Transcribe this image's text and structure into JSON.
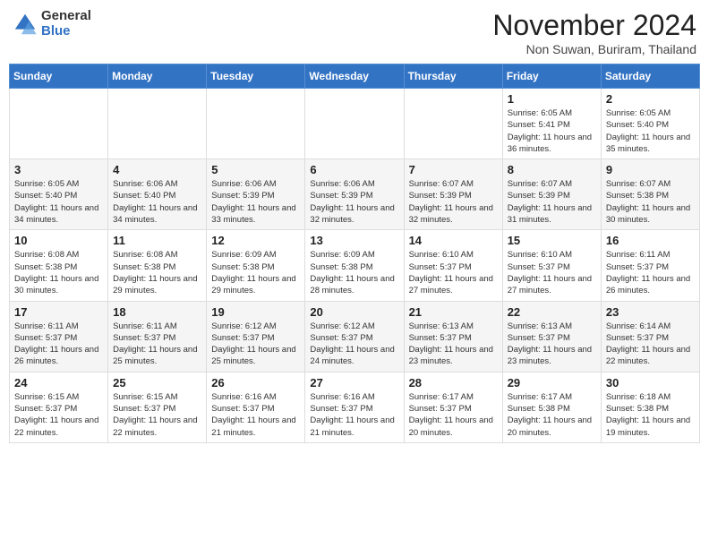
{
  "header": {
    "logo_general": "General",
    "logo_blue": "Blue",
    "month_title": "November 2024",
    "location": "Non Suwan, Buriram, Thailand"
  },
  "weekdays": [
    "Sunday",
    "Monday",
    "Tuesday",
    "Wednesday",
    "Thursday",
    "Friday",
    "Saturday"
  ],
  "weeks": [
    [
      {
        "day": "",
        "info": ""
      },
      {
        "day": "",
        "info": ""
      },
      {
        "day": "",
        "info": ""
      },
      {
        "day": "",
        "info": ""
      },
      {
        "day": "",
        "info": ""
      },
      {
        "day": "1",
        "info": "Sunrise: 6:05 AM\nSunset: 5:41 PM\nDaylight: 11 hours and 36 minutes."
      },
      {
        "day": "2",
        "info": "Sunrise: 6:05 AM\nSunset: 5:40 PM\nDaylight: 11 hours and 35 minutes."
      }
    ],
    [
      {
        "day": "3",
        "info": "Sunrise: 6:05 AM\nSunset: 5:40 PM\nDaylight: 11 hours and 34 minutes."
      },
      {
        "day": "4",
        "info": "Sunrise: 6:06 AM\nSunset: 5:40 PM\nDaylight: 11 hours and 34 minutes."
      },
      {
        "day": "5",
        "info": "Sunrise: 6:06 AM\nSunset: 5:39 PM\nDaylight: 11 hours and 33 minutes."
      },
      {
        "day": "6",
        "info": "Sunrise: 6:06 AM\nSunset: 5:39 PM\nDaylight: 11 hours and 32 minutes."
      },
      {
        "day": "7",
        "info": "Sunrise: 6:07 AM\nSunset: 5:39 PM\nDaylight: 11 hours and 32 minutes."
      },
      {
        "day": "8",
        "info": "Sunrise: 6:07 AM\nSunset: 5:39 PM\nDaylight: 11 hours and 31 minutes."
      },
      {
        "day": "9",
        "info": "Sunrise: 6:07 AM\nSunset: 5:38 PM\nDaylight: 11 hours and 30 minutes."
      }
    ],
    [
      {
        "day": "10",
        "info": "Sunrise: 6:08 AM\nSunset: 5:38 PM\nDaylight: 11 hours and 30 minutes."
      },
      {
        "day": "11",
        "info": "Sunrise: 6:08 AM\nSunset: 5:38 PM\nDaylight: 11 hours and 29 minutes."
      },
      {
        "day": "12",
        "info": "Sunrise: 6:09 AM\nSunset: 5:38 PM\nDaylight: 11 hours and 29 minutes."
      },
      {
        "day": "13",
        "info": "Sunrise: 6:09 AM\nSunset: 5:38 PM\nDaylight: 11 hours and 28 minutes."
      },
      {
        "day": "14",
        "info": "Sunrise: 6:10 AM\nSunset: 5:37 PM\nDaylight: 11 hours and 27 minutes."
      },
      {
        "day": "15",
        "info": "Sunrise: 6:10 AM\nSunset: 5:37 PM\nDaylight: 11 hours and 27 minutes."
      },
      {
        "day": "16",
        "info": "Sunrise: 6:11 AM\nSunset: 5:37 PM\nDaylight: 11 hours and 26 minutes."
      }
    ],
    [
      {
        "day": "17",
        "info": "Sunrise: 6:11 AM\nSunset: 5:37 PM\nDaylight: 11 hours and 26 minutes."
      },
      {
        "day": "18",
        "info": "Sunrise: 6:11 AM\nSunset: 5:37 PM\nDaylight: 11 hours and 25 minutes."
      },
      {
        "day": "19",
        "info": "Sunrise: 6:12 AM\nSunset: 5:37 PM\nDaylight: 11 hours and 25 minutes."
      },
      {
        "day": "20",
        "info": "Sunrise: 6:12 AM\nSunset: 5:37 PM\nDaylight: 11 hours and 24 minutes."
      },
      {
        "day": "21",
        "info": "Sunrise: 6:13 AM\nSunset: 5:37 PM\nDaylight: 11 hours and 23 minutes."
      },
      {
        "day": "22",
        "info": "Sunrise: 6:13 AM\nSunset: 5:37 PM\nDaylight: 11 hours and 23 minutes."
      },
      {
        "day": "23",
        "info": "Sunrise: 6:14 AM\nSunset: 5:37 PM\nDaylight: 11 hours and 22 minutes."
      }
    ],
    [
      {
        "day": "24",
        "info": "Sunrise: 6:15 AM\nSunset: 5:37 PM\nDaylight: 11 hours and 22 minutes."
      },
      {
        "day": "25",
        "info": "Sunrise: 6:15 AM\nSunset: 5:37 PM\nDaylight: 11 hours and 22 minutes."
      },
      {
        "day": "26",
        "info": "Sunrise: 6:16 AM\nSunset: 5:37 PM\nDaylight: 11 hours and 21 minutes."
      },
      {
        "day": "27",
        "info": "Sunrise: 6:16 AM\nSunset: 5:37 PM\nDaylight: 11 hours and 21 minutes."
      },
      {
        "day": "28",
        "info": "Sunrise: 6:17 AM\nSunset: 5:37 PM\nDaylight: 11 hours and 20 minutes."
      },
      {
        "day": "29",
        "info": "Sunrise: 6:17 AM\nSunset: 5:38 PM\nDaylight: 11 hours and 20 minutes."
      },
      {
        "day": "30",
        "info": "Sunrise: 6:18 AM\nSunset: 5:38 PM\nDaylight: 11 hours and 19 minutes."
      }
    ]
  ]
}
